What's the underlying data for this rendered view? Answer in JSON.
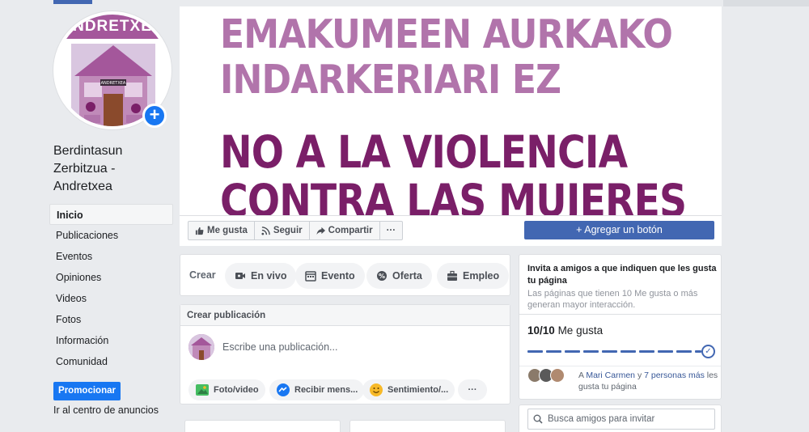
{
  "avatar": {
    "banner_text": "NDRETXE",
    "house_sign": "ANDRETXEA",
    "add_symbol": "+"
  },
  "page": {
    "name": "Berdintasun Zerbitzua - Andretxea"
  },
  "sidebar": {
    "items": [
      {
        "label": "Inicio"
      },
      {
        "label": "Publicaciones"
      },
      {
        "label": "Eventos"
      },
      {
        "label": "Opiniones"
      },
      {
        "label": "Videos"
      },
      {
        "label": "Fotos"
      },
      {
        "label": "Información"
      },
      {
        "label": "Comunidad"
      }
    ],
    "promote_label": "Promocionar",
    "ads_link": "Ir al centro de anuncios"
  },
  "cover": {
    "line1": "EMAKUMEEN AURKAKO",
    "line2": "INDARKERIARI EZ",
    "line3": "NO A LA VIOLENCIA",
    "line4": "CONTRA LAS MUJERES"
  },
  "actions": {
    "like": "Me gusta",
    "follow": "Seguir",
    "share": "Compartir",
    "more": "···",
    "add_button": "Agregar un botón"
  },
  "create": {
    "label": "Crear",
    "chips": [
      {
        "label": "En vivo",
        "icon": "live-video-icon"
      },
      {
        "label": "Evento",
        "icon": "calendar-icon"
      },
      {
        "label": "Oferta",
        "icon": "offer-icon"
      },
      {
        "label": "Empleo",
        "icon": "briefcase-icon"
      }
    ]
  },
  "composer": {
    "header": "Crear publicación",
    "placeholder": "Escribe una publicación...",
    "photo": "Foto/video",
    "messages": "Recibir mens...",
    "feeling": "Sentimiento/...",
    "more": "···"
  },
  "invite": {
    "title": "Invita a amigos a que indiquen que les gusta tu página",
    "subtitle": "Las páginas que tienen 10 Me gusta o más generan mayor interacción.",
    "count": "10/10",
    "count_label": "Me gusta",
    "progress": 1.0,
    "friends_prefix": "A ",
    "friend_name": "Mari Carmen",
    "friends_and": " y ",
    "friends_more": "7 personas más",
    "friends_suffix": " les gusta tu página"
  },
  "search": {
    "placeholder": "Busca amigos para invitar"
  },
  "colors": {
    "brand": "#4267b2",
    "button_blue": "#1877f2",
    "cover_light": "#b174ab",
    "cover_dark": "#7a1f68"
  }
}
